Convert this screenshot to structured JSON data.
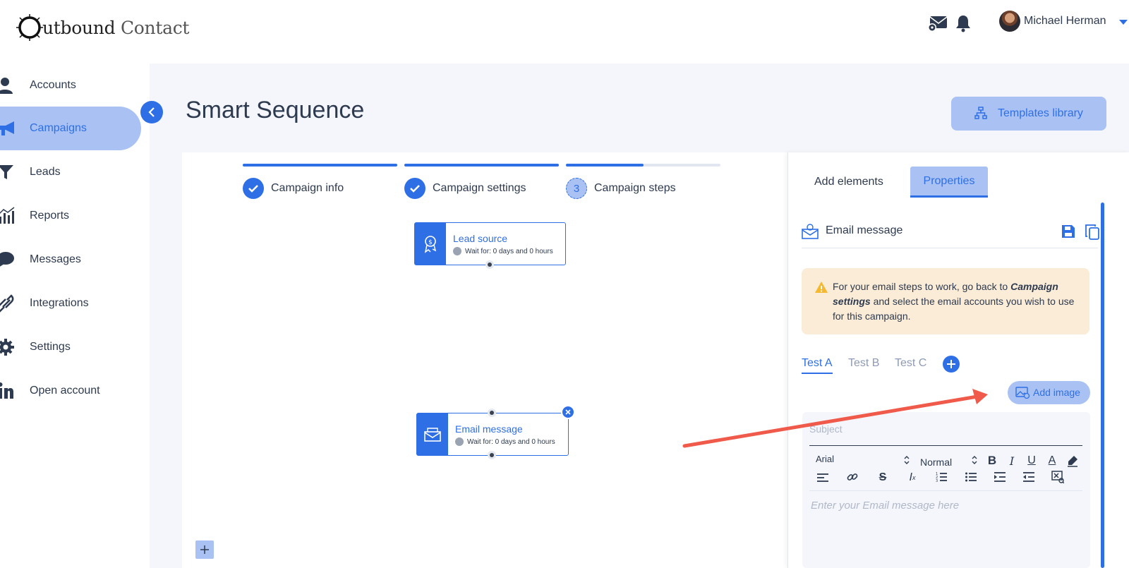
{
  "header": {
    "logo_first": "utbound",
    "logo_second": "Contact",
    "user_name": "Michael Herman",
    "icons": [
      "mail-settings-icon",
      "bell-icon",
      "avatar",
      "caret-down-icon"
    ]
  },
  "sidebar": {
    "items": [
      {
        "label": "Accounts",
        "icon": "person-icon"
      },
      {
        "label": "Campaigns",
        "icon": "megaphone-icon",
        "active": true
      },
      {
        "label": "Leads",
        "icon": "funnel-icon"
      },
      {
        "label": "Reports",
        "icon": "chart-icon"
      },
      {
        "label": "Messages",
        "icon": "chat-icon"
      },
      {
        "label": "Integrations",
        "icon": "link-icon"
      },
      {
        "label": "Settings",
        "icon": "gear-icon"
      },
      {
        "label": "Open account",
        "icon": "linkedin-icon"
      }
    ]
  },
  "page": {
    "title": "Smart Sequence",
    "templates_button": "Templates library"
  },
  "stepper": {
    "steps": [
      {
        "label": "Campaign info",
        "state": "done",
        "progress": 1.0
      },
      {
        "label": "Campaign settings",
        "state": "done",
        "progress": 1.0
      },
      {
        "label": "Campaign steps",
        "state": "current",
        "number": "3",
        "progress": 0.5
      }
    ]
  },
  "nodes": {
    "lead_source": {
      "title": "Lead source",
      "wait": "Wait for: 0 days and 0 hours"
    },
    "email_message": {
      "title": "Email message",
      "wait": "Wait for: 0 days and 0 hours"
    }
  },
  "panel": {
    "tabs": {
      "add_elements": "Add elements",
      "properties": "Properties"
    },
    "element_title": "Email message",
    "warning": {
      "before": "For your email steps to work, go back to ",
      "emphasis": "Campaign settings",
      "after": " and select the email accounts you wish to use for this campaign."
    },
    "tests": [
      "Test A",
      "Test B",
      "Test C"
    ],
    "add_image": "Add image",
    "subject_placeholder": "Subject",
    "font": "Arial",
    "size": "Normal",
    "body_placeholder": "Enter your Email message here"
  },
  "colors": {
    "accent": "#2e6fe6",
    "accent_light": "#a9c2f3",
    "warning_bg": "#fbecd7",
    "annotation_arrow": "#f05a4a"
  }
}
